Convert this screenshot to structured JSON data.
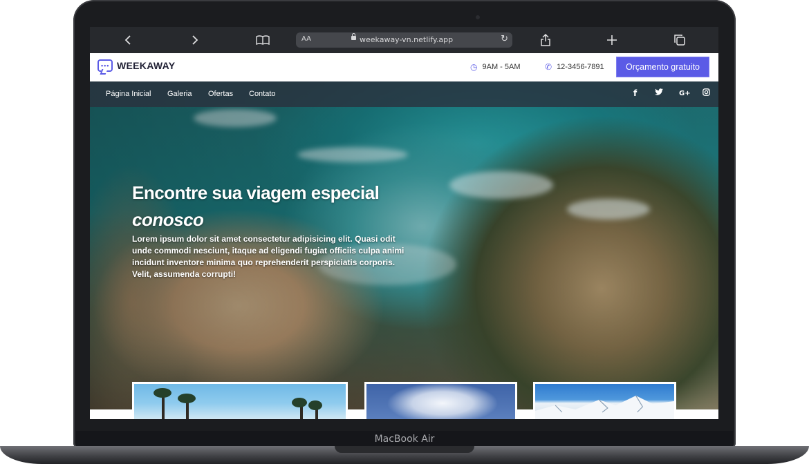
{
  "device_label": "MacBook Air",
  "browser": {
    "back_icon": "chevron-left-icon",
    "forward_icon": "chevron-right-icon",
    "reader_font_label": "AA",
    "url": "weekaway-vn.netlify.app"
  },
  "header": {
    "brand": "WEEKAWAY",
    "hours": "9AM - 5AM",
    "phone": "12-3456-7891",
    "cta_label": "Orçamento gratuito"
  },
  "nav": {
    "items": [
      "Página Inicial",
      "Galeria",
      "Ofertas",
      "Contato"
    ],
    "social": [
      "facebook-icon",
      "twitter-icon",
      "google-plus-icon",
      "instagram-icon"
    ]
  },
  "hero": {
    "title_line1": "Encontre sua viagem especial",
    "title_line2": "conosco",
    "text": "Lorem ipsum dolor sit amet consectetur adipisicing elit. Quasi odit unde commodi nesciunt, itaque ad eligendi fugiat officiis culpa animi incidunt inventore minima quo reprehenderit perspiciatis corporis. Velit, assumenda corrupti!"
  },
  "colors": {
    "accent": "#5b5be6",
    "nav_bg": "#2a303c",
    "safari_bar": "#27292d"
  }
}
